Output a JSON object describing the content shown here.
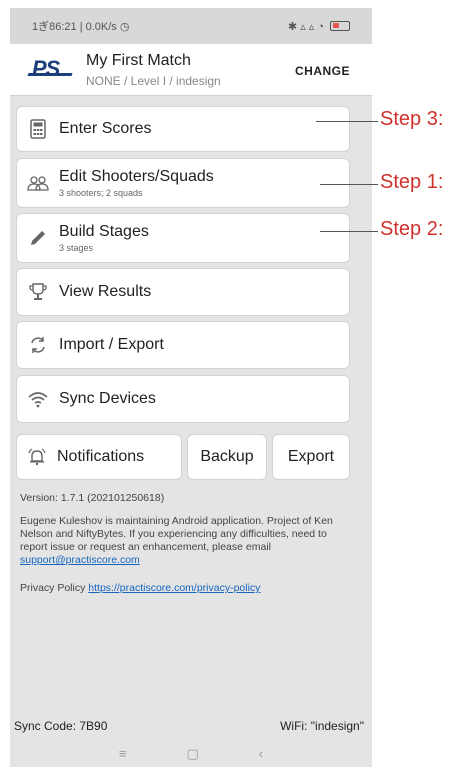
{
  "status_bar": {
    "left_text": "1ぎ86:21 | 0.0K/s ◷",
    "right_text": "✱ ▵ ▵ ◔"
  },
  "header": {
    "logo": "PS",
    "title": "My First Match",
    "subtitle": "NONE / Level I / indesign",
    "change_label": "CHANGE"
  },
  "menu": {
    "enter_scores": {
      "label": "Enter Scores",
      "icon": "calculator-icon"
    },
    "edit_shooters": {
      "label": "Edit Shooters/Squads",
      "sub": "3 shooters; 2 squads",
      "icon": "people-icon"
    },
    "build_stages": {
      "label": "Build Stages",
      "sub": "3 stages",
      "icon": "pencil-icon"
    },
    "view_results": {
      "label": "View Results",
      "icon": "trophy-icon"
    },
    "import_export": {
      "label": "Import / Export",
      "icon": "sync-arrows-icon"
    },
    "sync_devices": {
      "label": "Sync Devices",
      "icon": "wifi-icon"
    },
    "notifications": {
      "label": "Notifications",
      "icon": "bell-icon"
    },
    "backup": {
      "label": "Backup"
    },
    "export": {
      "label": "Export"
    }
  },
  "footer": {
    "version": "Version: 1.7.1 (202101250618)",
    "about": "Eugene Kuleshov is maintaining Android application. Project of Ken Nelson and NiftyBytes. If you experiencing any difficulties, need to report issue or request an enhancement, please email",
    "email": "support@practiscore.com",
    "privacy_label": "Privacy Policy",
    "privacy_link": "https://practiscore.com/privacy-policy"
  },
  "sync": {
    "code": "Sync Code: 7B90",
    "wifi": "WiFi: \"indesign\""
  },
  "nav": {
    "menu": "≡",
    "home": "▢",
    "back": "‹"
  },
  "annotations": {
    "step3": "Step 3:",
    "step1": "Step 1:",
    "step2": "Step 2:"
  },
  "colors": {
    "annotation": "#d0312d",
    "brand": "#1b3f7a",
    "link": "#1565c0"
  }
}
